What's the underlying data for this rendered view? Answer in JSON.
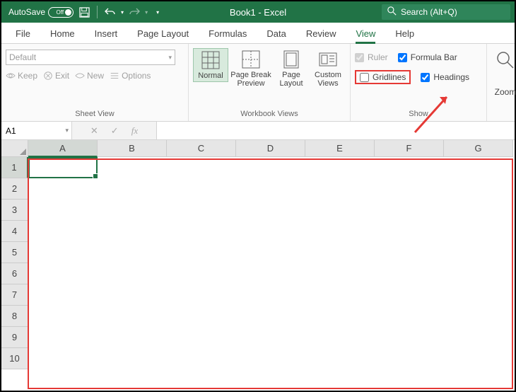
{
  "titlebar": {
    "autosave_label": "AutoSave",
    "autosave_state": "Off",
    "document_title": "Book1  -  Excel",
    "search_placeholder": "Search (Alt+Q)"
  },
  "tabs": [
    "File",
    "Home",
    "Insert",
    "Page Layout",
    "Formulas",
    "Data",
    "Review",
    "View",
    "Help"
  ],
  "active_tab": "View",
  "ribbon": {
    "sheet_view": {
      "combo_value": "Default",
      "keep": "Keep",
      "exit": "Exit",
      "new": "New",
      "options": "Options",
      "group_label": "Sheet View"
    },
    "workbook_views": {
      "normal": "Normal",
      "page_break": "Page Break Preview",
      "page_layout": "Page Layout",
      "custom": "Custom Views",
      "group_label": "Workbook Views"
    },
    "show": {
      "ruler": "Ruler",
      "formula_bar": "Formula Bar",
      "gridlines": "Gridlines",
      "headings": "Headings",
      "group_label": "Show"
    },
    "zoom": {
      "label": "Zoom"
    }
  },
  "namebox": {
    "value": "A1"
  },
  "fx": {
    "label": "fx"
  },
  "columns": [
    "A",
    "B",
    "C",
    "D",
    "E",
    "F",
    "G"
  ],
  "rows": [
    "1",
    "2",
    "3",
    "4",
    "5",
    "6",
    "7",
    "8",
    "9",
    "10"
  ]
}
